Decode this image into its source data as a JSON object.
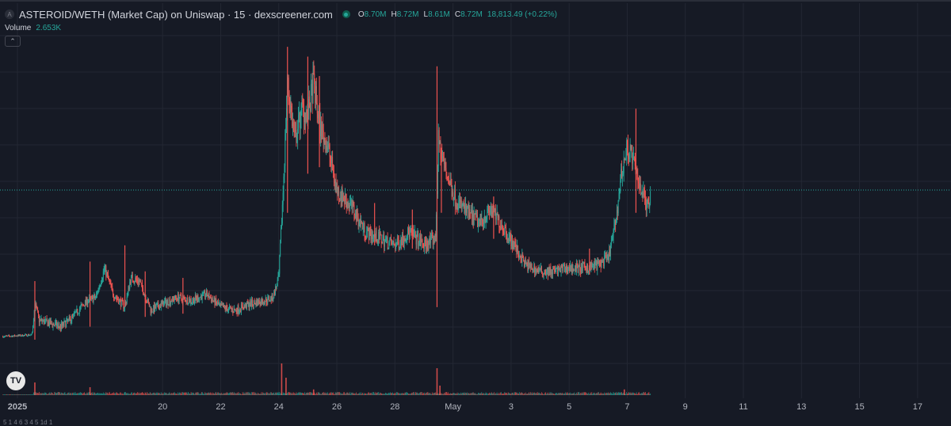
{
  "header": {
    "symbol_icon": "asteroid-token-icon",
    "title": "ASTEROID/WETH (Market Cap) on Uniswap · 15 · dexscreener.com",
    "live_dot_color": "#26a69a",
    "ohlc": [
      {
        "key": "O",
        "value": "8.70M"
      },
      {
        "key": "H",
        "value": "8.72M"
      },
      {
        "key": "L",
        "value": "8.61M"
      },
      {
        "key": "C",
        "value": "8.72M"
      },
      {
        "key": "",
        "value": "18,813.49 (+0.22%)"
      }
    ]
  },
  "volume": {
    "label": "Volume",
    "value": "2.653K"
  },
  "collapse_icon": "chevron-up-icon",
  "logo": {
    "text": "TV",
    "icon": "tradingview-logo-icon"
  },
  "bottom_glyphs": "5 1 4 6 3 4 5 1d 1",
  "colors": {
    "up": "#26a69a",
    "down": "#ef5350",
    "grid": "#232733",
    "background": "#161a25"
  },
  "chart_data": {
    "type": "candlestick",
    "interval": "15",
    "x_ticks": [
      {
        "t": 0,
        "label": "2025",
        "bold": true
      },
      {
        "t": 5,
        "label": "20"
      },
      {
        "t": 7,
        "label": "22"
      },
      {
        "t": 9,
        "label": "24"
      },
      {
        "t": 11,
        "label": "26"
      },
      {
        "t": 13,
        "label": "28"
      },
      {
        "t": 15,
        "label": "May"
      },
      {
        "t": 17,
        "label": "3"
      },
      {
        "t": 19,
        "label": "5"
      },
      {
        "t": 21,
        "label": "7"
      },
      {
        "t": 23,
        "label": "9"
      },
      {
        "t": 25,
        "label": "11"
      },
      {
        "t": 27,
        "label": "13"
      },
      {
        "t": 29,
        "label": "15"
      },
      {
        "t": 31,
        "label": "17"
      }
    ],
    "x_range": [
      -0.6,
      32.15
    ],
    "y_range": [
      0,
      100
    ],
    "last_value": 55,
    "grid": true,
    "price_path": [
      [
        -0.5,
        10
      ],
      [
        0.5,
        10.5
      ],
      [
        0.6,
        20
      ],
      [
        0.75,
        15
      ],
      [
        1.5,
        13
      ],
      [
        1.8,
        15
      ],
      [
        2.1,
        18
      ],
      [
        2.4,
        21
      ],
      [
        2.7,
        22
      ],
      [
        3.0,
        31
      ],
      [
        3.3,
        23
      ],
      [
        3.7,
        19
      ],
      [
        3.9,
        28
      ],
      [
        4.2,
        27
      ],
      [
        4.6,
        18
      ],
      [
        5.0,
        20
      ],
      [
        5.5,
        22
      ],
      [
        6.0,
        21
      ],
      [
        6.5,
        23
      ],
      [
        7.0,
        19
      ],
      [
        7.5,
        18
      ],
      [
        8.0,
        20
      ],
      [
        8.5,
        21
      ],
      [
        8.8,
        22
      ],
      [
        9.0,
        28
      ],
      [
        9.15,
        55
      ],
      [
        9.3,
        88
      ],
      [
        9.55,
        70
      ],
      [
        9.8,
        80
      ],
      [
        10.0,
        78
      ],
      [
        10.2,
        88
      ],
      [
        10.4,
        75
      ],
      [
        10.7,
        68
      ],
      [
        11.0,
        55
      ],
      [
        11.5,
        50
      ],
      [
        12.0,
        42
      ],
      [
        12.5,
        40
      ],
      [
        13.0,
        38
      ],
      [
        13.5,
        42
      ],
      [
        14.0,
        38
      ],
      [
        14.4,
        40
      ],
      [
        14.5,
        70
      ],
      [
        14.65,
        64
      ],
      [
        14.85,
        58
      ],
      [
        15.1,
        52
      ],
      [
        15.5,
        48
      ],
      [
        15.9,
        45
      ],
      [
        16.3,
        49
      ],
      [
        16.7,
        44
      ],
      [
        17.1,
        38
      ],
      [
        17.5,
        32
      ],
      [
        18.0,
        30
      ],
      [
        18.5,
        30
      ],
      [
        19.0,
        31
      ],
      [
        19.5,
        31
      ],
      [
        20.0,
        32
      ],
      [
        20.35,
        34
      ],
      [
        20.6,
        45
      ],
      [
        20.8,
        60
      ],
      [
        21.0,
        68
      ],
      [
        21.15,
        66
      ],
      [
        21.3,
        60
      ],
      [
        21.5,
        55
      ],
      [
        21.7,
        50
      ],
      [
        21.8,
        54
      ]
    ],
    "spikes": [
      {
        "t": 0.6,
        "high": 27,
        "low": 9
      },
      {
        "t": 2.5,
        "high": 33,
        "low": 13
      },
      {
        "t": 3.7,
        "high": 38,
        "low": 19
      },
      {
        "t": 4.4,
        "high": 30,
        "low": 16
      },
      {
        "t": 5.7,
        "high": 28,
        "low": 17
      },
      {
        "t": 9.3,
        "high": 99,
        "low": 48
      },
      {
        "t": 10.0,
        "high": 96,
        "low": 60
      },
      {
        "t": 10.4,
        "high": 90,
        "low": 62
      },
      {
        "t": 12.3,
        "high": 51,
        "low": 38
      },
      {
        "t": 13.6,
        "high": 49,
        "low": 37
      },
      {
        "t": 14.45,
        "high": 93,
        "low": 19
      },
      {
        "t": 14.6,
        "high": 68,
        "low": 48
      },
      {
        "t": 16.4,
        "high": 53,
        "low": 40
      },
      {
        "t": 19.7,
        "high": 37,
        "low": 29
      },
      {
        "t": 21.3,
        "high": 80,
        "low": 48
      }
    ],
    "volume_spikes": [
      {
        "t": 0.6,
        "value": 40
      },
      {
        "t": 2.5,
        "value": 25
      },
      {
        "t": 9.1,
        "value": 100
      },
      {
        "t": 9.25,
        "value": 55
      },
      {
        "t": 10.2,
        "value": 18
      },
      {
        "t": 14.45,
        "value": 85
      },
      {
        "t": 14.55,
        "value": 30
      },
      {
        "t": 20.9,
        "value": 18
      }
    ]
  }
}
